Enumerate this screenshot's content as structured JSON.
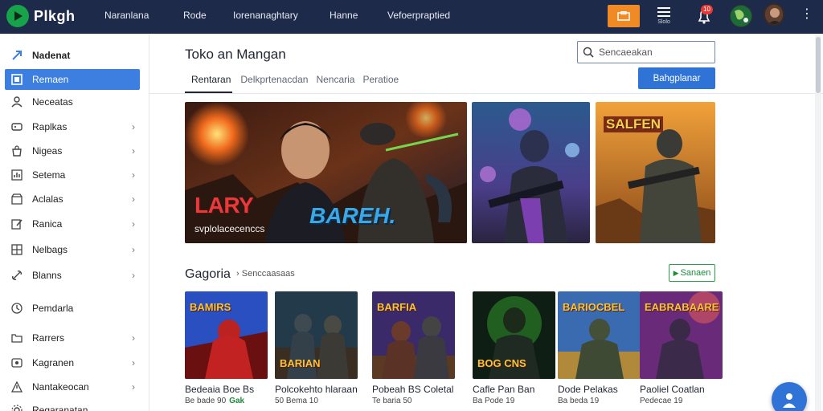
{
  "topbar": {
    "app_name": "Plkgh",
    "nav": [
      "Naranlana",
      "Rode",
      "Iorenanaghtary",
      "Hanne",
      "Vefoerpraptied"
    ],
    "menu_label": "Slolo",
    "notification_count": "10",
    "icons": {
      "store": "store-icon",
      "menu": "menu-icon",
      "notifications": "bell-icon",
      "globe": "globe-icon",
      "more": "more-vertical-icon"
    }
  },
  "sidebar": {
    "items": [
      {
        "label": "Nadenat",
        "icon": "arrow-icon",
        "active": false,
        "chevron": false
      },
      {
        "label": "Remaen",
        "icon": "square-icon",
        "active": true,
        "chevron": false
      },
      {
        "label": "Neceatas",
        "icon": "person-icon",
        "active": false,
        "chevron": false
      },
      {
        "label": "Raplkas",
        "icon": "gamepad-icon",
        "active": false,
        "chevron": true
      },
      {
        "label": "Nigeas",
        "icon": "bag-icon",
        "active": false,
        "chevron": true
      },
      {
        "label": "Setema",
        "icon": "chart-icon",
        "active": false,
        "chevron": true
      },
      {
        "label": "Aclalas",
        "icon": "box-icon",
        "active": false,
        "chevron": true
      },
      {
        "label": "Ranica",
        "icon": "edit-icon",
        "active": false,
        "chevron": true
      },
      {
        "label": "Nelbags",
        "icon": "grid-icon",
        "active": false,
        "chevron": true
      },
      {
        "label": "Blanns",
        "icon": "link-icon",
        "active": false,
        "chevron": true
      },
      {
        "label": "Pemdarla",
        "icon": "clock-icon",
        "active": false,
        "chevron": false
      },
      {
        "label": "Rarrers",
        "icon": "folder-icon",
        "active": false,
        "chevron": true
      },
      {
        "label": "Kagranen",
        "icon": "eye-icon",
        "active": false,
        "chevron": true
      },
      {
        "label": "Nantakeocan",
        "icon": "warning-icon",
        "active": false,
        "chevron": true
      },
      {
        "label": "Regaranatan",
        "icon": "gear-icon",
        "active": false,
        "chevron": false
      }
    ]
  },
  "main": {
    "title": "Toko an Mangan",
    "search": {
      "placeholder": "Sencaeakan"
    },
    "tabs": [
      "Rentaran",
      "Delkprtenacdan",
      "Nencaria",
      "Peratioe"
    ],
    "primary_button": "Bahgplanar",
    "banners": [
      {
        "title": "LARY",
        "subtitle": "svplolacecenccs",
        "title2": "BAREH."
      },
      {
        "title": ""
      },
      {
        "title": "SALFEN"
      }
    ],
    "section": {
      "title": "Gagoria",
      "crumb": "Senccaasaas",
      "button": "Sanaen"
    },
    "cards": [
      {
        "thumb_title": "BAMIRS",
        "name": "Bedeaia Boe Bs",
        "meta": "Be bade 90",
        "tag": "Gak"
      },
      {
        "thumb_title": "BARIAN",
        "name": "Polcokehto hlaraan",
        "meta": "50 Bema 10",
        "tag": ""
      },
      {
        "thumb_title": "BARFIA",
        "name": "Pobeah BS Coletal",
        "meta": "Te baria 50",
        "tag": ""
      },
      {
        "thumb_title": "BOG CNS",
        "name": "Cafle Pan Ban",
        "meta": "Ba Pode 19",
        "tag": ""
      },
      {
        "thumb_title": "BARIOCBEL",
        "name": "Dode Pelakas",
        "meta": "Ba beda 19",
        "tag": ""
      },
      {
        "thumb_title": "EABRABAARE",
        "name": "Paoliel Coatlan",
        "meta": "Pedecae 19",
        "tag": ""
      }
    ]
  }
}
